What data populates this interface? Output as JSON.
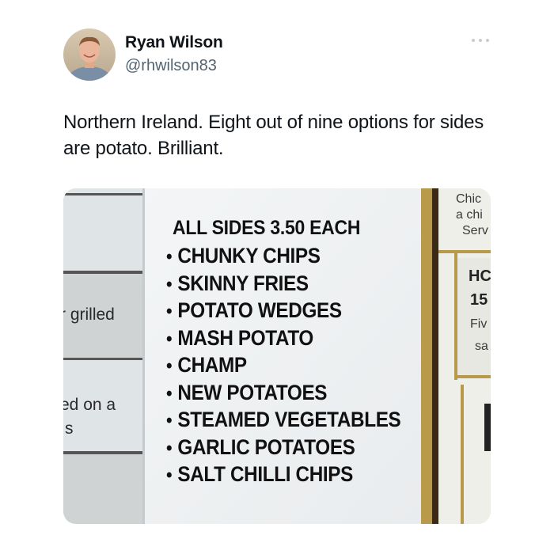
{
  "author": {
    "display_name": "Ryan Wilson",
    "handle": "@rhwilson83",
    "avatar_icon": "user-avatar-photo"
  },
  "more_icon": "more-options-icon",
  "tweet": {
    "text": "Northern Ireland. Eight out of nine options for sides are potato. Brilliant."
  },
  "photo": {
    "heading": "ALL SIDES 3.50 EACH",
    "items": [
      "CHUNKY CHIPS",
      "SKINNY FRIES",
      "POTATO WEDGES",
      "MASH POTATO",
      "CHAMP",
      "NEW POTATOES",
      "STEAMED VEGETABLES",
      "GARLIC POTATOES",
      "SALT CHILLI CHIPS"
    ],
    "bullet": "•",
    "left_fragments": [
      "r grilled",
      "ed on a",
      "s"
    ],
    "right_fragments": [
      "Chic",
      "a chi",
      "Serv",
      "HC",
      "15",
      "Fiv",
      "sa"
    ]
  }
}
